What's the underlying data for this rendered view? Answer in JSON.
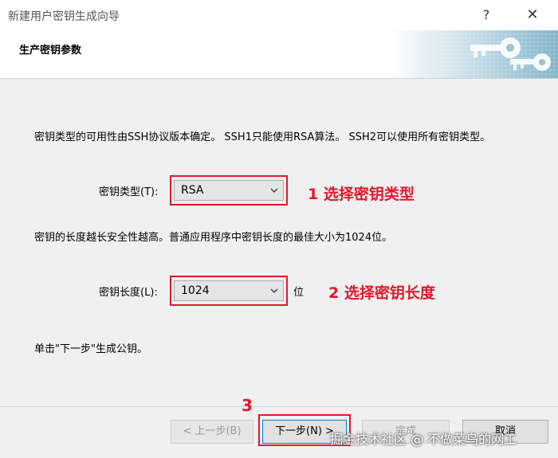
{
  "window": {
    "title": "新建用户密钥生成向导",
    "help_glyph": "?",
    "close_glyph": "✕"
  },
  "header": {
    "title": "生产密钥参数",
    "art_icon": "keys-icon"
  },
  "content": {
    "intro": "密钥类型的可用性由SSH协议版本确定。 SSH1只能使用RSA算法。 SSH2可以使用所有密钥类型。",
    "key_type_label": "密钥类型(T):",
    "key_type_value": "RSA",
    "length_info": "密钥的长度越长安全性越高。普通应用程序中密钥长度的最佳大小为1024位。",
    "key_length_label": "密钥长度(L):",
    "key_length_value": "1024",
    "key_length_unit": "位",
    "hint": "单击\"下一步\"生成公钥。"
  },
  "annotations": {
    "step1": "1 选择密钥类型",
    "step2": "2 选择密钥长度",
    "step3": "3"
  },
  "buttons": {
    "prev": "< 上一步(B)",
    "next": "下一步(N) >",
    "finish": "完成",
    "cancel": "取消"
  },
  "watermark": "掘金技术社区 @ 不做菜鸟的网工",
  "colors": {
    "annotation_red": "#e0182d",
    "dialog_bg": "#f0f0f0",
    "focus_blue": "#0078d7"
  }
}
